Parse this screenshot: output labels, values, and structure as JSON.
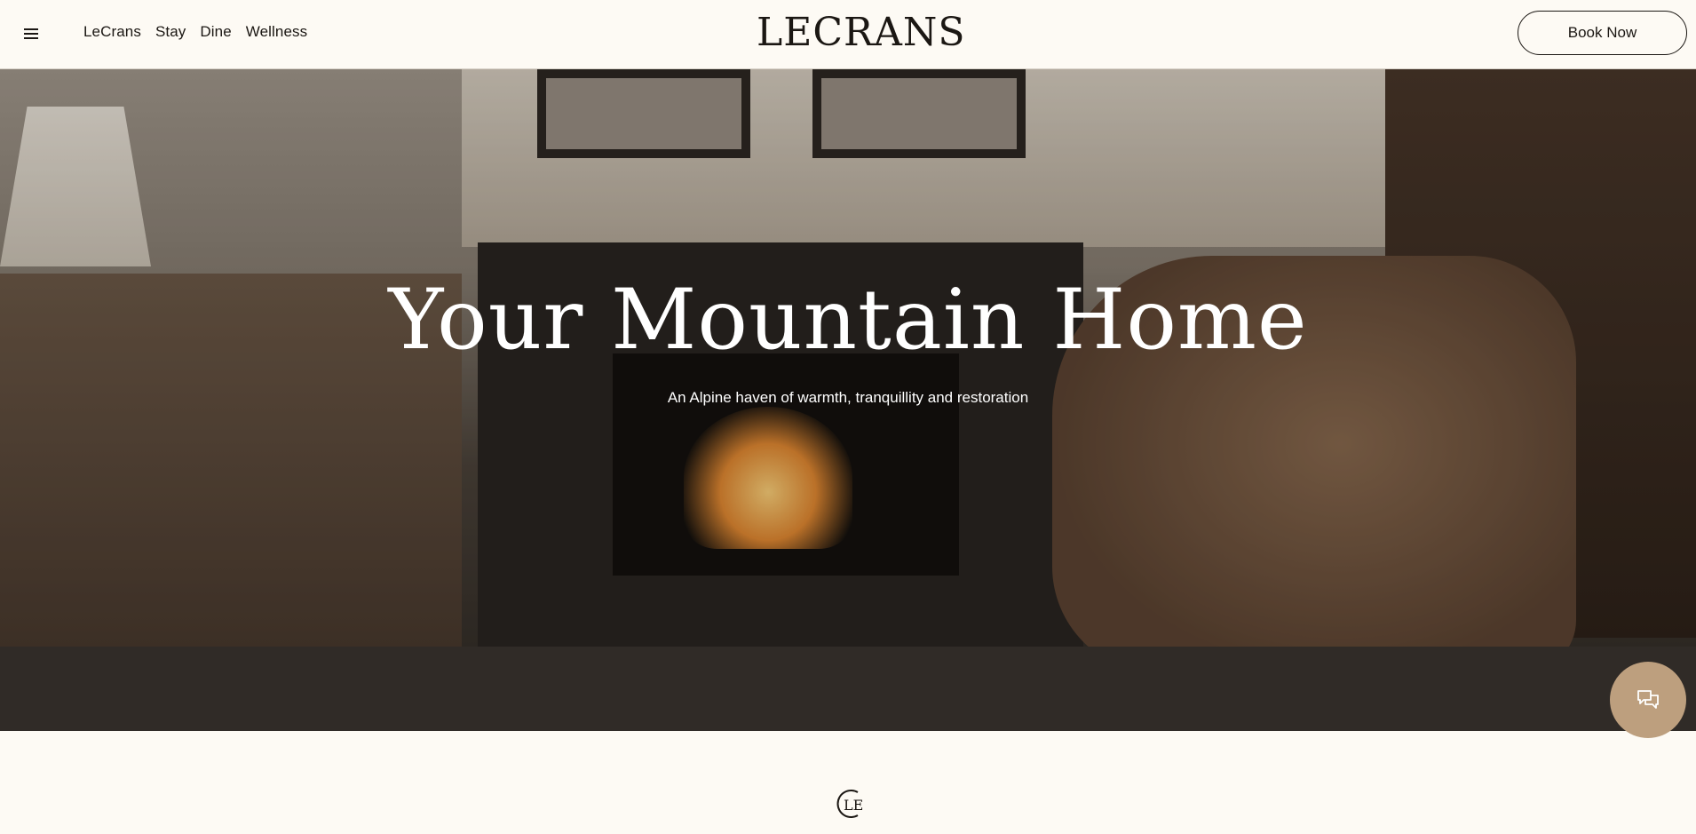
{
  "header": {
    "menu_icon": "hamburger-menu-icon",
    "nav": [
      {
        "label": "LeCrans"
      },
      {
        "label": "Stay"
      },
      {
        "label": "Dine"
      },
      {
        "label": "Wellness"
      }
    ],
    "logo": "LECRANS",
    "book_label": "Book Now"
  },
  "hero": {
    "title": "Your Mountain Home",
    "subtitle": "An Alpine haven of warmth, tranquillity and restoration"
  },
  "chat": {
    "icon": "chat-bubbles-icon",
    "color": "#bd9f7e"
  },
  "emblem": {
    "icon": "le-monogram-icon"
  }
}
